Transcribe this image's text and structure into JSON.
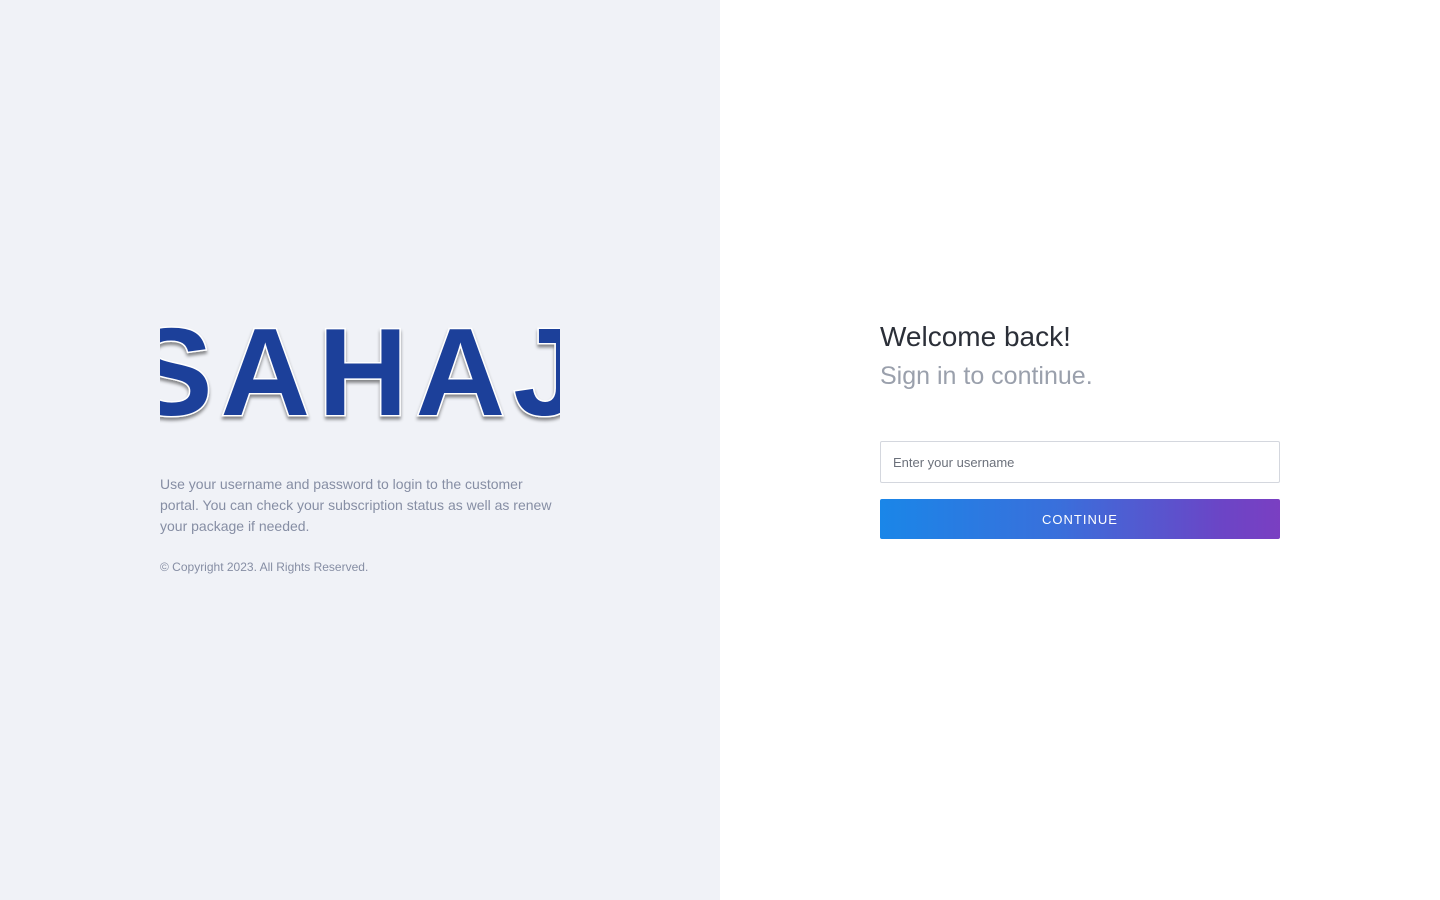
{
  "brand": {
    "logo_text": "SAHAJ",
    "logo_color": "#1d409a"
  },
  "intro": {
    "description": "Use your username and password to login to the customer portal. You can check your subscription status as well as renew your package if needed.",
    "copyright": "© Copyright 2023. All Rights Reserved."
  },
  "login": {
    "title": "Welcome back!",
    "subtitle": "Sign in to continue.",
    "username_placeholder": "Enter your username",
    "username_value": "",
    "continue_label": "CONTINUE"
  },
  "colors": {
    "left_background": "#f0f2f7",
    "right_background": "#ffffff",
    "button_gradient_start": "#1a86e8",
    "button_gradient_end": "#7a3fc2",
    "muted_text": "#868ea4"
  }
}
